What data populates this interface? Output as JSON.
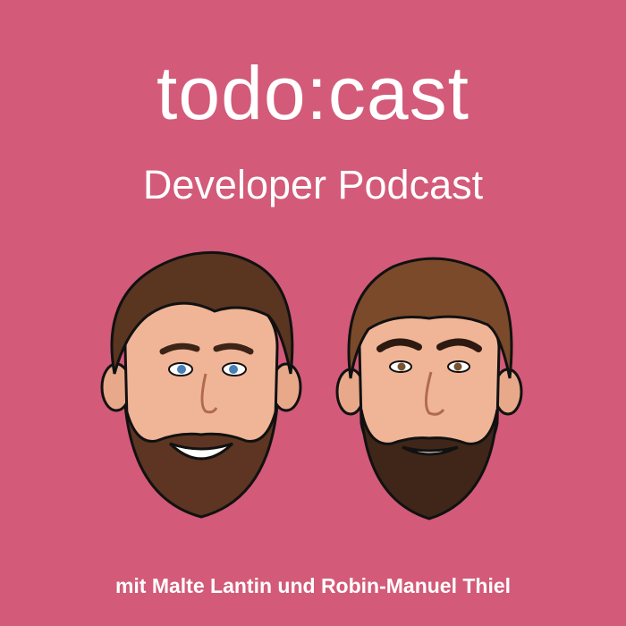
{
  "cover": {
    "title": "todo:cast",
    "subtitle": "Developer Podcast",
    "byline": "mit Malte Lantin und Robin-Manuel Thiel",
    "background_color": "#d35a78",
    "text_color": "#ffffff"
  },
  "illustrations": [
    {
      "name": "host-left-face",
      "description_icon": "bearded-man-smiling-illustration"
    },
    {
      "name": "host-right-face",
      "description_icon": "bearded-man-grin-illustration"
    }
  ]
}
